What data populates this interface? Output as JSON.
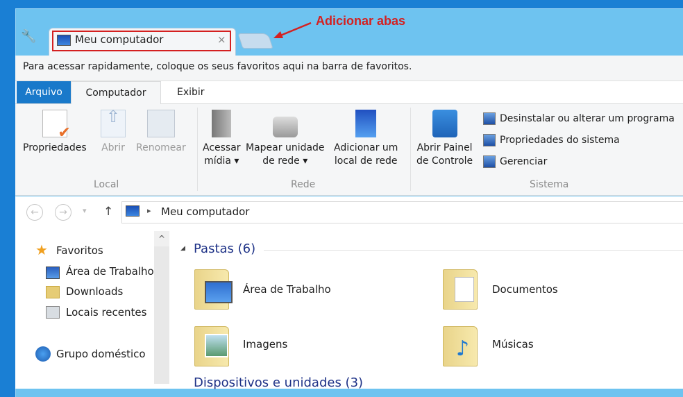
{
  "window": {
    "tab_title": "Meu computador",
    "tab_close": "×",
    "annotation": "Adicionar abas"
  },
  "favorites_bar": {
    "text": "Para acessar rapidamente, coloque os seus favoritos aqui na barra de favoritos."
  },
  "ribbon_tabs": [
    "Arquivo",
    "Computador",
    "Exibir"
  ],
  "ribbon": {
    "local": {
      "label": "Local",
      "buttons": [
        "Propriedades",
        "Abrir",
        "Renomear"
      ]
    },
    "rede": {
      "label": "Rede",
      "buttons": [
        [
          "Acessar",
          "mídia ▾"
        ],
        [
          "Mapear unidade",
          "de rede ▾"
        ],
        [
          "Adicionar um",
          "local de rede"
        ]
      ]
    },
    "sistema": {
      "label": "Sistema",
      "big": [
        "Abrir Painel",
        "de Controle"
      ],
      "items": [
        "Desinstalar ou alterar um programa",
        "Propriedades do sistema",
        "Gerenciar"
      ]
    }
  },
  "address": {
    "back": "←",
    "forward": "→",
    "dropdown": "▾",
    "up": "↑",
    "sep": "▸",
    "path": "Meu computador"
  },
  "nav": {
    "favorites": "Favoritos",
    "items": [
      "Área de Trabalho",
      "Downloads",
      "Locais recentes"
    ],
    "homegroup": "Grupo doméstico",
    "scroll_up": "^"
  },
  "content": {
    "group_title": "Pastas (6)",
    "collapse": "◢",
    "folders": [
      "Área de Trabalho",
      "Documentos",
      "Imagens",
      "Músicas"
    ],
    "next_group": "Dispositivos e unidades (3)"
  }
}
